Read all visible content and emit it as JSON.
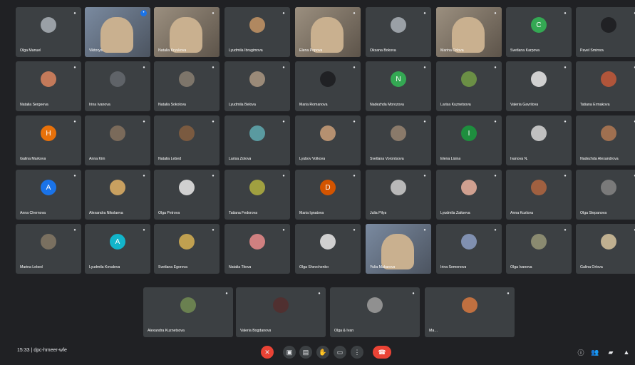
{
  "colors": {
    "background": "#202124",
    "tile": "#3c4043",
    "accent_blue": "#1a73e8",
    "danger_red": "#ea4335",
    "teal": "#12b5cb",
    "green": "#34a853",
    "orange": "#e8710a"
  },
  "tiles": [
    {
      "name": "Olga Manuel",
      "type": "avatar",
      "avatar_color": "#9aa0a6",
      "initial": ""
    },
    {
      "name": "Viktorya",
      "type": "video",
      "pinned": true
    },
    {
      "name": "Natalia Kryukova",
      "type": "video"
    },
    {
      "name": "Lyudmila Ibragimova",
      "type": "avatar",
      "avatar_color": "#b08860",
      "initial": ""
    },
    {
      "name": "Elena Popova",
      "type": "video"
    },
    {
      "name": "Oksana Bokova",
      "type": "avatar",
      "avatar_color": "#9aa0a6",
      "initial": ""
    },
    {
      "name": "Marina Orlova",
      "type": "video"
    },
    {
      "name": "Svetlana Karpova",
      "type": "avatar",
      "avatar_color": "#34a853",
      "initial": "С"
    },
    {
      "name": "Pavel Smirnov",
      "type": "avatar",
      "avatar_color": "#202124",
      "initial": ""
    },
    {
      "name": "Natalia Sergeeva",
      "type": "avatar",
      "avatar_color": "#c47a5a",
      "initial": ""
    },
    {
      "name": "Irina Ivanova",
      "type": "avatar",
      "avatar_color": "#5f6368",
      "initial": ""
    },
    {
      "name": "Natalia Sokolova",
      "type": "avatar",
      "avatar_color": "#7d756a",
      "initial": ""
    },
    {
      "name": "Lyudmila Belova",
      "type": "avatar",
      "avatar_color": "#9a8a78",
      "initial": ""
    },
    {
      "name": "Maria Romanova",
      "type": "avatar",
      "avatar_color": "#202124",
      "initial": ""
    },
    {
      "name": "Nadezhda Morozova",
      "type": "avatar",
      "avatar_color": "#34a853",
      "initial": "N"
    },
    {
      "name": "Larisa Kuznetsova",
      "type": "avatar",
      "avatar_color": "#6b8f45",
      "initial": ""
    },
    {
      "name": "Valeria Gavrilova",
      "type": "avatar",
      "avatar_color": "#d0d0d0",
      "initial": ""
    },
    {
      "name": "Tatiana Ermakova",
      "type": "avatar",
      "avatar_color": "#b0553a",
      "initial": ""
    },
    {
      "name": "Galina Markova",
      "type": "avatar",
      "avatar_color": "#e8710a",
      "initial": "Н"
    },
    {
      "name": "Anna Kim",
      "type": "avatar",
      "avatar_color": "#7a6a5a",
      "initial": ""
    },
    {
      "name": "Natalia Lebed",
      "type": "avatar",
      "avatar_color": "#7a5a40",
      "initial": ""
    },
    {
      "name": "Larisa Zotova",
      "type": "avatar",
      "avatar_color": "#5a9aa0",
      "initial": ""
    },
    {
      "name": "Lyubov Volkova",
      "type": "avatar",
      "avatar_color": "#b59070",
      "initial": ""
    },
    {
      "name": "Svetlana Vorontsova",
      "type": "avatar",
      "avatar_color": "#8a7a6a",
      "initial": ""
    },
    {
      "name": "Elena Lisina",
      "type": "avatar",
      "avatar_color": "#1e8e3e",
      "initial": "I"
    },
    {
      "name": "Ivanova N.",
      "type": "avatar",
      "avatar_color": "#c0c0c0",
      "initial": ""
    },
    {
      "name": "Nadezhda Alexandrova",
      "type": "avatar",
      "avatar_color": "#a07050",
      "initial": ""
    },
    {
      "name": "Anna Chernova",
      "type": "avatar",
      "avatar_color": "#1a73e8",
      "initial": "A"
    },
    {
      "name": "Alexandra Nikolaeva",
      "type": "avatar",
      "avatar_color": "#c8a060",
      "initial": ""
    },
    {
      "name": "Olga Petrova",
      "type": "avatar",
      "avatar_color": "#d0d0d0",
      "initial": ""
    },
    {
      "name": "Tatiana Fedorova",
      "type": "avatar",
      "avatar_color": "#a0a040",
      "initial": ""
    },
    {
      "name": "Maria Ignatova",
      "type": "avatar",
      "avatar_color": "#d35400",
      "initial": "D"
    },
    {
      "name": "Julia Pilya",
      "type": "avatar",
      "avatar_color": "#b8b8b8",
      "initial": ""
    },
    {
      "name": "Lyudmila Zaitseva",
      "type": "avatar",
      "avatar_color": "#d0a090",
      "initial": ""
    },
    {
      "name": "Anna Kozlova",
      "type": "avatar",
      "avatar_color": "#a06040",
      "initial": ""
    },
    {
      "name": "Olga Stepanova",
      "type": "avatar",
      "avatar_color": "#7a7a7a",
      "initial": ""
    },
    {
      "name": "Marina Lebed",
      "type": "avatar",
      "avatar_color": "#7a7060",
      "initial": ""
    },
    {
      "name": "Lyudmila Kovaleva",
      "type": "avatar",
      "avatar_color": "#12b5cb",
      "initial": "A"
    },
    {
      "name": "Svetlana Egorova",
      "type": "avatar",
      "avatar_color": "#c0a050",
      "initial": ""
    },
    {
      "name": "Natalia Titova",
      "type": "avatar",
      "avatar_color": "#d08080",
      "initial": ""
    },
    {
      "name": "Olga Shevchenko",
      "type": "avatar",
      "avatar_color": "#d0d0d0",
      "initial": ""
    },
    {
      "name": "Yulia Makarova",
      "type": "video"
    },
    {
      "name": "Irina Semenova",
      "type": "avatar",
      "avatar_color": "#8090b0",
      "initial": ""
    },
    {
      "name": "Olga Ivanova",
      "type": "avatar",
      "avatar_color": "#8a8a70",
      "initial": ""
    },
    {
      "name": "Galina Orlova",
      "type": "avatar",
      "avatar_color": "#c0b090",
      "initial": ""
    },
    {
      "name": "Alexandra Kuznetsova",
      "type": "avatar",
      "avatar_color": "#6a8050",
      "initial": ""
    },
    {
      "name": "Valeria Bogdanova",
      "type": "avatar",
      "avatar_color": "#503030",
      "initial": ""
    },
    {
      "name": "Olga & Ivan",
      "type": "avatar",
      "avatar_color": "#909090",
      "initial": ""
    },
    {
      "name": "Ma…",
      "type": "avatar",
      "avatar_color": "#c07040",
      "initial": ""
    }
  ],
  "bottom_bar": {
    "meeting_info": "15:33  |  dpc-hmeer-wfe",
    "controls": [
      {
        "name": "mic-button",
        "icon": "mic-off-icon",
        "glyph": "✕",
        "red": true
      },
      {
        "name": "camera-button",
        "icon": "camera-icon",
        "glyph": "▣",
        "red": false
      },
      {
        "name": "captions-button",
        "icon": "captions-icon",
        "glyph": "▤",
        "red": false
      },
      {
        "name": "raise-hand-button",
        "icon": "hand-icon",
        "glyph": "✋",
        "red": false
      },
      {
        "name": "present-button",
        "icon": "present-icon",
        "glyph": "▭",
        "red": false
      },
      {
        "name": "more-options-button",
        "icon": "more-icon",
        "glyph": "⋮",
        "red": false
      }
    ],
    "end_call_glyph": "☎",
    "right_icons": [
      {
        "name": "info-button",
        "icon": "info-icon",
        "glyph": "ⓘ"
      },
      {
        "name": "people-button",
        "icon": "people-icon",
        "glyph": "👥"
      },
      {
        "name": "chat-button",
        "icon": "chat-icon",
        "glyph": "▰"
      },
      {
        "name": "activities-button",
        "icon": "activities-icon",
        "glyph": "▲"
      }
    ]
  }
}
